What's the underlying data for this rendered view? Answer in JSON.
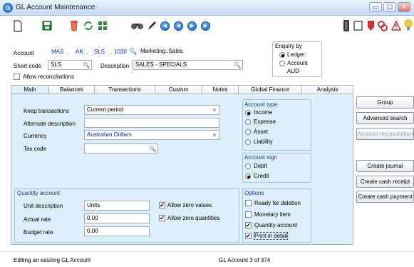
{
  "window": {
    "title": "GL Account Maintenance",
    "app_icon": "G"
  },
  "window_buttons": {
    "minimize": "▭",
    "restore": "☐",
    "close": "✕"
  },
  "toolbar": {
    "nav_icons": [
      "◀",
      "◀",
      "▶",
      "▶"
    ]
  },
  "header": {
    "account_label": "Account",
    "account_segments": [
      "MAS",
      "AK",
      "SLS",
      "1030"
    ],
    "account_separator": ".",
    "account_name": "Marketing..Sales.",
    "short_code_label": "Short code",
    "short_code_value": "SLS",
    "description_label": "Description",
    "description_value": "SALES - SPECIALS",
    "allow_reconciliations_label": "Allow reconciliations",
    "allow_reconciliations": false
  },
  "enquiry": {
    "title": "Enquiry by",
    "options": [
      "Ledger",
      "Account"
    ],
    "selected": "Ledger",
    "currency_code": "AUD"
  },
  "tabs": [
    "Main",
    "Balances",
    "Transactions",
    "Custom",
    "Notes",
    "Global Finance",
    "Analysis"
  ],
  "active_tab": "Main",
  "main": {
    "keep_transactions_label": "Keep transactions",
    "keep_transactions_value": "Current period",
    "alternate_description_label": "Alternate description",
    "alternate_description_value": "",
    "currency_label": "Currency",
    "currency_value": "Australian Dollars",
    "tax_code_label": "Tax code",
    "tax_code_value": "",
    "quantity_group_title": "Quantity account",
    "unit_description_label": "Unit description",
    "unit_description_value": "Units",
    "actual_rate_label": "Actual rate",
    "actual_rate_value": "0.00",
    "budget_rate_label": "Budget rate",
    "budget_rate_value": "0.00",
    "allow_zero_values_label": "Allow zero values",
    "allow_zero_values": true,
    "allow_zero_quantities_label": "Allow zero quantities",
    "allow_zero_quantities": true
  },
  "account_type": {
    "title": "Account type",
    "options": [
      "Income",
      "Expense",
      "Asset",
      "Liability"
    ],
    "selected": "Income"
  },
  "account_sign": {
    "title": "Account sign",
    "options": [
      "Debit",
      "Credit"
    ],
    "selected": "Credit"
  },
  "options_group": {
    "title": "Options",
    "items": [
      {
        "label": "Ready for deletion",
        "checked": false
      },
      {
        "label": "Monetary item",
        "checked": false
      },
      {
        "label": "Quantity account",
        "checked": true
      },
      {
        "label": "Print in detail",
        "checked": true
      }
    ]
  },
  "side_buttons": {
    "group": "Group",
    "advanced_search": "Advanced search",
    "account_reconciliation": "Account reconciliation",
    "create_journal": "Create journal",
    "create_cash_receipt": "Create cash receipt",
    "create_cash_payment": "Create cash payment"
  },
  "status": {
    "left": "Editing an existing GL Account",
    "center": "GL Account 3 of 374"
  },
  "colors": {
    "panel": "#dceefa",
    "title_gradient_top": "#e9f2fc",
    "accent_blue": "#1162c9"
  }
}
